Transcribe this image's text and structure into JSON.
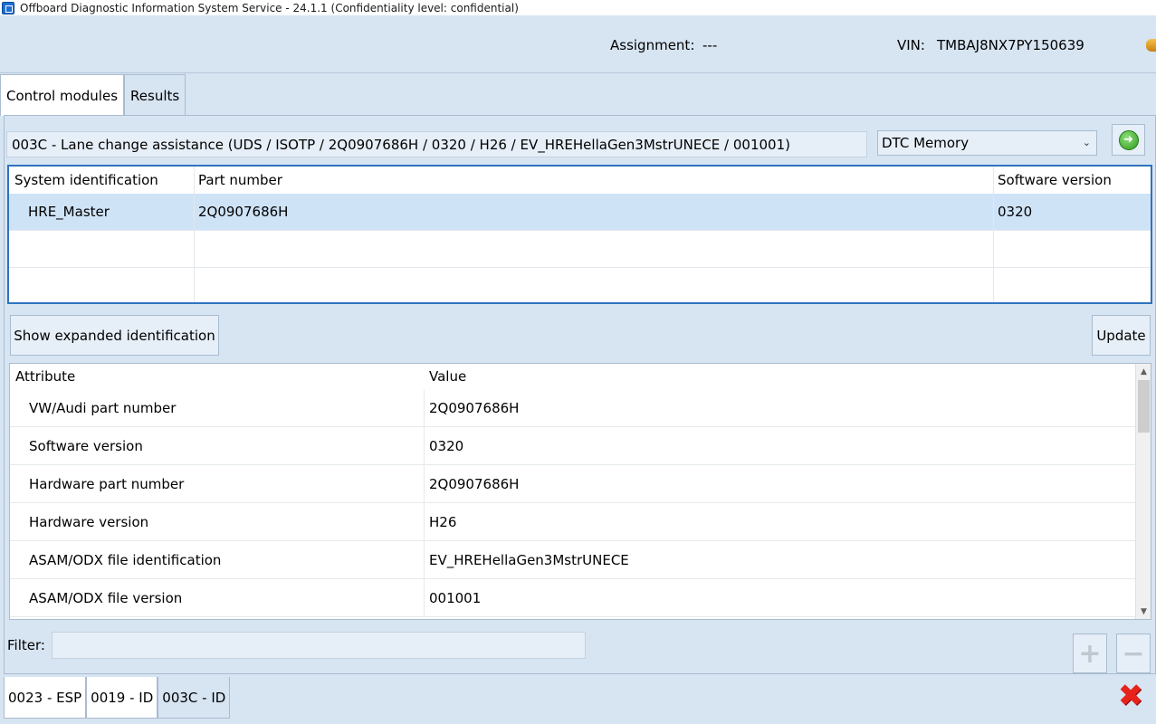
{
  "window": {
    "title": "Offboard Diagnostic Information System Service - 24.1.1 (Confidentiality level: confidential)"
  },
  "header": {
    "assignment_label": "Assignment:",
    "assignment_value": "---",
    "vin_label": "VIN:",
    "vin_value": "TMBAJ8NX7PY150639"
  },
  "top_tabs": [
    {
      "label": "Control modules",
      "active": true
    },
    {
      "label": "Results",
      "active": false
    }
  ],
  "module": {
    "description": "003C - Lane change assistance  (UDS / ISOTP / 2Q0907686H / 0320 / H26 / EV_HREHellaGen3MstrUNECE / 001001)",
    "selected_view": "DTC Memory"
  },
  "identification_table": {
    "columns": [
      "System identification",
      "Part number",
      "Software version"
    ],
    "rows": [
      {
        "system": "HRE_Master",
        "part_number": "2Q0907686H",
        "software_version": "0320"
      },
      {
        "system": "",
        "part_number": "",
        "software_version": ""
      },
      {
        "system": "",
        "part_number": "",
        "software_version": ""
      }
    ]
  },
  "buttons": {
    "expand": "Show expanded identification",
    "update": "Update",
    "add": "+",
    "remove": "−"
  },
  "attribute_table": {
    "columns": [
      "Attribute",
      "Value"
    ],
    "rows": [
      {
        "attribute": "VW/Audi part number",
        "value": "2Q0907686H"
      },
      {
        "attribute": "Software version",
        "value": "0320"
      },
      {
        "attribute": "Hardware part number",
        "value": "2Q0907686H"
      },
      {
        "attribute": "Hardware version",
        "value": "H26"
      },
      {
        "attribute": "ASAM/ODX file identification",
        "value": "EV_HREHellaGen3MstrUNECE"
      },
      {
        "attribute": "ASAM/ODX file version",
        "value": "001001"
      }
    ]
  },
  "filter": {
    "label": "Filter:",
    "value": ""
  },
  "bottom_tabs": [
    {
      "label": "0023 - ESP"
    },
    {
      "label": "0019 - ID"
    },
    {
      "label": "003C - ID"
    }
  ],
  "icons": {
    "go": "green-arrow-right-icon",
    "close": "red-x-close-icon",
    "dropdown": "chevron-down-icon"
  },
  "colors": {
    "background": "#d7e4f2",
    "selection": "#cfe3f7",
    "focus_border": "#2f73bf",
    "close": "#e8231c",
    "go": "#2e9a1f"
  }
}
